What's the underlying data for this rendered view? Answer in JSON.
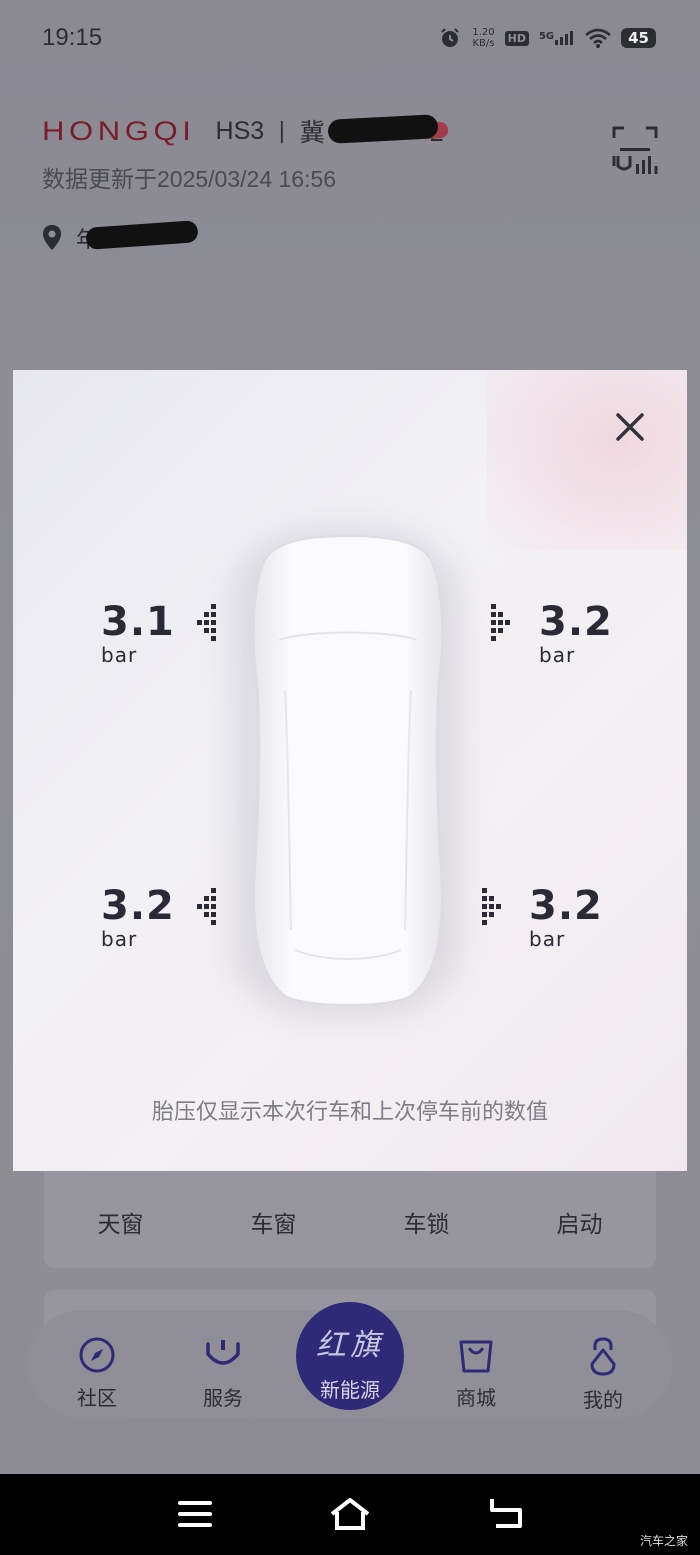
{
  "status_bar": {
    "time": "19:15",
    "net_speed_value": "1.20",
    "net_speed_unit": "KB/s",
    "hd_label": "HD",
    "network_label": "5G",
    "battery": "45",
    "icons": [
      "alarm-icon",
      "hd-icon",
      "signal-5g-icon",
      "wifi-icon",
      "battery-icon"
    ]
  },
  "vehicle": {
    "brand": "HONGQI",
    "model": "HS3",
    "separator": "|",
    "plate": "冀",
    "plate_suffix": "L",
    "update_time": "数据更新于2025/03/24 16:56",
    "location": "年"
  },
  "controls": {
    "items": [
      "天窗",
      "车窗",
      "车锁",
      "启动"
    ]
  },
  "bottom_nav": {
    "items": [
      {
        "label": "社区",
        "icon": "compass-icon"
      },
      {
        "label": "服务",
        "icon": "smile-service-icon"
      },
      {
        "label": "新能源",
        "icon": "hongqi-logo",
        "logo_text": "红旗"
      },
      {
        "label": "商城",
        "icon": "shopping-bag-icon"
      },
      {
        "label": "我的",
        "icon": "profile-drop-icon"
      }
    ]
  },
  "tire_modal": {
    "close_icon": "close-icon",
    "front_left": {
      "value": "3.1",
      "unit": "bar"
    },
    "front_right": {
      "value": "3.2",
      "unit": "bar"
    },
    "rear_left": {
      "value": "3.2",
      "unit": "bar"
    },
    "rear_right": {
      "value": "3.2",
      "unit": "bar"
    },
    "note": "胎压仅显示本次行车和上次停车前的数值"
  },
  "system_nav": {
    "buttons": [
      "menu-icon",
      "home-icon",
      "back-icon"
    ]
  },
  "watermark": "汽车之家",
  "colors": {
    "brand_red": "#7a1d2a",
    "nav_center_bg": "#2e2a78",
    "modal_bg": "#f2f1f5",
    "text_dark": "#2a2a36"
  }
}
